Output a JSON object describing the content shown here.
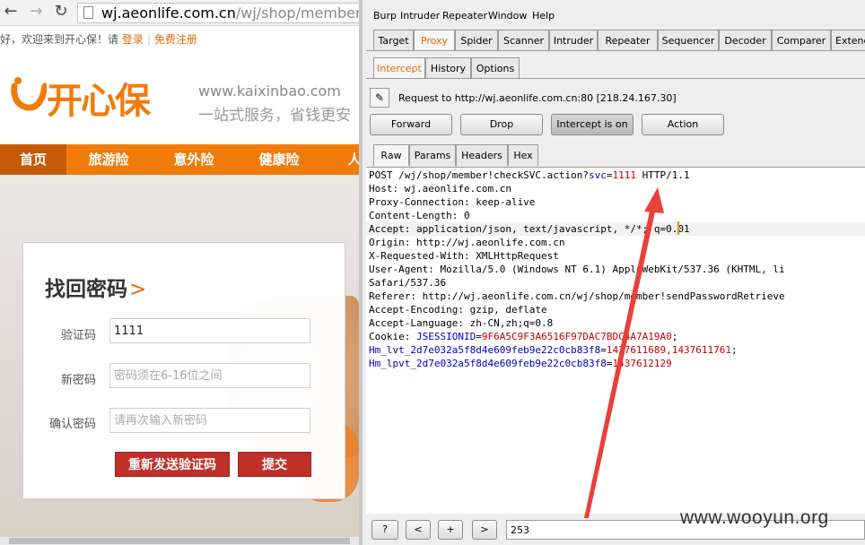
{
  "browser": {
    "url_host": "wj.aeonlife.com.cn",
    "url_path": "/wj/shop/member",
    "back_icon": "back-arrow-icon",
    "forward_icon": "forward-arrow-icon",
    "reload_icon": "reload-icon"
  },
  "site": {
    "welcome": "您好，欢迎来到开心保！请",
    "login": "登录",
    "register": "免费注册",
    "logo_text": "开心保",
    "domain": "www.kaixinbao.com",
    "slogan": "一站式服务，省钱更安",
    "nav": [
      "首页",
      "旅游险",
      "意外险",
      "健康险",
      "人"
    ],
    "brand_color": "#f07b0b"
  },
  "form": {
    "title": "找回密码",
    "title_arrow": ">",
    "captcha_label": "验证码",
    "captcha_value": "1111",
    "newpwd_label": "新密码",
    "newpwd_placeholder": "密码须在6-16位之间",
    "confirm_label": "确认密码",
    "confirm_placeholder": "请再次输入新密码",
    "resend_button": "重新发送验证码",
    "submit_button": "提交"
  },
  "burp": {
    "menu": [
      "Burp",
      "Intruder",
      "Repeater",
      "Window",
      "Help"
    ],
    "main_tabs": [
      "Target",
      "Proxy",
      "Spider",
      "Scanner",
      "Intruder",
      "Repeater",
      "Sequencer",
      "Decoder",
      "Comparer",
      "Extende"
    ],
    "proxy_tabs": [
      "Intercept",
      "History",
      "Options"
    ],
    "request_label": "Request to http://wj.aeonlife.com.cn:80  [218.24.167.30]",
    "buttons": [
      "Forward",
      "Drop",
      "Intercept is on",
      "Action"
    ],
    "view_tabs": [
      "Raw",
      "Params",
      "Headers",
      "Hex"
    ],
    "request": {
      "line1_pre": "POST /wj/shop/member!checkSVC.action?",
      "param_name": "svc",
      "param_eq": "=",
      "param_value": "1111",
      "line1_post": " HTTP/1.1",
      "headers": [
        "Host: wj.aeonlife.com.cn",
        "Proxy-Connection: keep-alive",
        "Content-Length: 0",
        "Accept: application/json, text/javascript, */*; q=0.01",
        "Origin: http://wj.aeonlife.com.cn",
        "X-Requested-With: XMLHttpRequest",
        "User-Agent: Mozilla/5.0 (Windows NT 6.1) AppleWebKit/537.36 (KHTML, li",
        "Safari/537.36",
        "Referer: http://wj.aeonlife.com.cn/wj/shop/member!sendPasswordRetrieve",
        "Accept-Encoding: gzip, deflate",
        "Accept-Language: zh-CN,zh;q=0.8"
      ],
      "cookie_label": "Cookie: ",
      "cookies": [
        {
          "name": "JSESSIONID",
          "value": "9F6A5C9F3A6516F97DAC7BDC4A7A19A0",
          "sep": ";"
        },
        {
          "name": "Hm_lvt_2d7e032a5f8d4e609feb9e22c0cb83f8",
          "value": "1437611689,1437611761",
          "sep": ";"
        },
        {
          "name": "Hm_lpvt_2d7e032a5f8d4e609feb9e22c0cb83f8",
          "value": "1437612129",
          "sep": ""
        }
      ]
    },
    "bottom": {
      "help": "?",
      "prev": "<",
      "add": "+",
      "next": ">",
      "search_value": "253"
    }
  },
  "watermark": "www.wooyun.org",
  "annotation_color": "#e8413a"
}
